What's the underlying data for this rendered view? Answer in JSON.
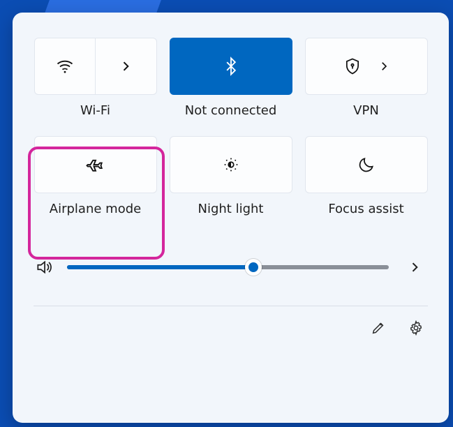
{
  "tiles": {
    "wifi": {
      "label": "Wi-Fi",
      "active": false,
      "has_expand": true
    },
    "bluetooth": {
      "label": "Not connected",
      "active": true,
      "has_expand": false
    },
    "vpn": {
      "label": "VPN",
      "active": false,
      "has_expand": true
    },
    "airplane": {
      "label": "Airplane mode",
      "active": false,
      "has_expand": false
    },
    "nightlight": {
      "label": "Night light",
      "active": false,
      "has_expand": false
    },
    "focus": {
      "label": "Focus assist",
      "active": false,
      "has_expand": false
    }
  },
  "volume": {
    "percent": 58
  },
  "highlight": "airplane",
  "colors": {
    "accent": "#0067c0",
    "highlight": "#d4269c"
  }
}
